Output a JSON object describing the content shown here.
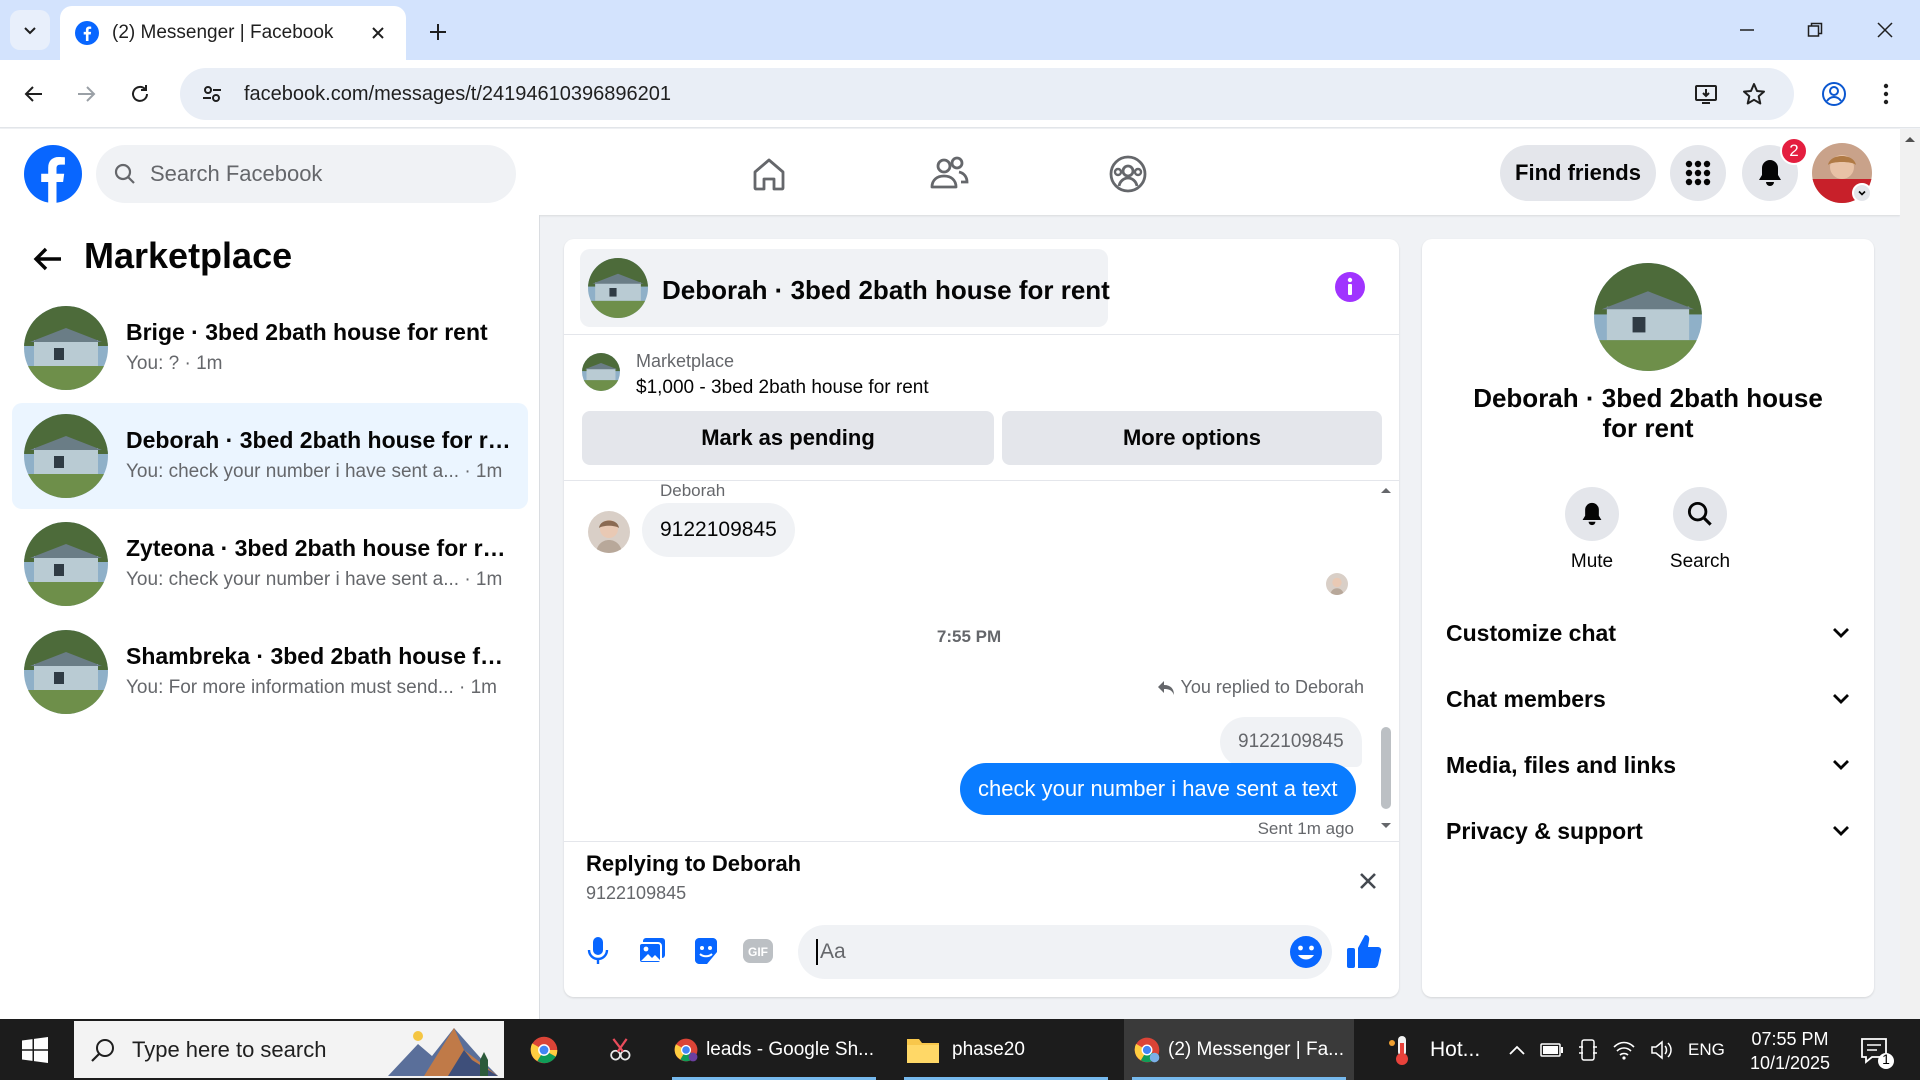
{
  "browser": {
    "tab_title": "(2) Messenger | Facebook",
    "url": "facebook.com/messages/t/24194610396896201"
  },
  "fb_header": {
    "search_placeholder": "Search Facebook",
    "find_friends": "Find friends",
    "notification_count": "2"
  },
  "left_panel": {
    "title": "Marketplace",
    "conversations": [
      {
        "name": "Brige · 3bed 2bath house for rent",
        "sub": "You: ? · 1m",
        "active": false
      },
      {
        "name": "Deborah · 3bed 2bath house for rent",
        "sub": "You: check your number i have sent a... · 1m",
        "active": true
      },
      {
        "name": "Zyteona · 3bed 2bath house for rent",
        "sub": "You: check your number i have sent a... · 1m",
        "active": false
      },
      {
        "name": "Shambreka · 3bed 2bath house for rent",
        "sub": "You: For more information must send... · 1m",
        "active": false
      }
    ]
  },
  "chat": {
    "header_name": "Deborah · 3bed 2bath house for rent",
    "marketplace_label": "Marketplace",
    "listing_title": "$1,000 - 3bed 2bath house for rent",
    "mark_pending": "Mark as pending",
    "more_options": "More options",
    "sender_name": "Deborah",
    "incoming_message": "9122109845",
    "timestamp": "7:55 PM",
    "replied_note": "You replied to Deborah",
    "quoted_message": "9122109845",
    "outgoing_message": "check your number i have sent a text",
    "sent_note": "Sent 1m ago",
    "replying_to": "Replying to Deborah",
    "replying_quote": "9122109845",
    "composer_placeholder": "Aa"
  },
  "right_panel": {
    "name": "Deborah · 3bed 2bath house for rent",
    "mute": "Mute",
    "search": "Search",
    "rows": [
      "Customize chat",
      "Chat members",
      "Media, files and links",
      "Privacy & support"
    ]
  },
  "taskbar": {
    "search_placeholder": "Type here to search",
    "apps": [
      "leads - Google Sh...",
      "phase20",
      "(2) Messenger | Fa..."
    ],
    "weather": "Hot...",
    "language": "ENG",
    "time": "07:55 PM",
    "date": "10/1/2025",
    "notification_count": "1"
  },
  "colors": {
    "fb_blue": "#0866ff",
    "messenger_blue": "#0a7cff",
    "info_purple": "#a033ff",
    "badge_red": "#e41e3f"
  }
}
